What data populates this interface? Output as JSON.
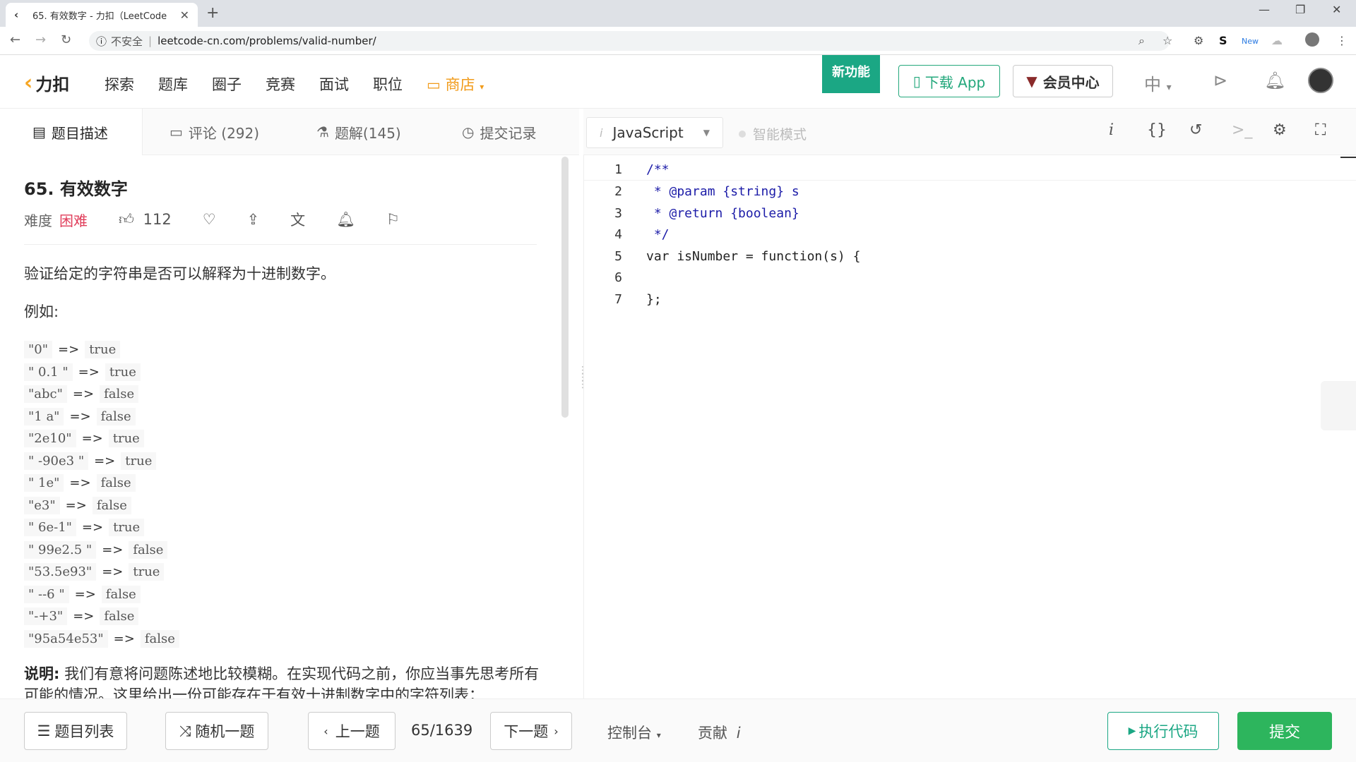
{
  "browser": {
    "tab_title": "65. 有效数字 - 力扣（LeetCode",
    "new_tab_symbol": "+",
    "security_label": "不安全",
    "url": "leetcode-cn.com/problems/valid-number/",
    "ext_new_badge": "New"
  },
  "header": {
    "logo_text": "力扣",
    "nav": [
      "探索",
      "题库",
      "圈子",
      "竞赛",
      "面试",
      "职位"
    ],
    "store_label": "商店",
    "new_feature_label": "新功能",
    "download_app_label": "下载 App",
    "vip_label": "会员中心",
    "lang_switch_label": "中"
  },
  "left_tabs": {
    "description": "题目描述",
    "comments": "评论 (292)",
    "solutions": "题解(145)",
    "submissions": "提交记录"
  },
  "problem": {
    "title": "65. 有效数字",
    "difficulty_label": "难度",
    "difficulty": "困难",
    "likes": "112",
    "description": "验证给定的字符串是否可以解释为十进制数字。",
    "example_label": "例如:",
    "examples": [
      {
        "input": "\"0\"",
        "output": "true"
      },
      {
        "input": "\" 0.1 \"",
        "output": "true"
      },
      {
        "input": "\"abc\"",
        "output": "false"
      },
      {
        "input": "\"1 a\"",
        "output": "false"
      },
      {
        "input": "\"2e10\"",
        "output": "true"
      },
      {
        "input": "\" -90e3      \"",
        "output": "true"
      },
      {
        "input": "\" 1e\"",
        "output": "false"
      },
      {
        "input": "\"e3\"",
        "output": "false"
      },
      {
        "input": "\" 6e-1\"",
        "output": "true"
      },
      {
        "input": "\" 99e2.5  \"",
        "output": "false"
      },
      {
        "input": "\"53.5e93\"",
        "output": "true"
      },
      {
        "input": "\" --6 \"",
        "output": "false"
      },
      {
        "input": "\"-+3\"",
        "output": "false"
      },
      {
        "input": "\"95a54e53\"",
        "output": "false"
      }
    ],
    "arrow": "=>",
    "note_label": "说明:",
    "note_text": "我们有意将问题陈述地比较模糊。在实现代码之前，你应当事先思考所有可能的情况。这里给出一份可能存在于有效十进制数字中的字符列表："
  },
  "editor": {
    "language": "JavaScript",
    "smart_mode_label": "智能模式",
    "lines": [
      {
        "num": "1",
        "text": "/**",
        "cls": "c-comment"
      },
      {
        "num": "2",
        "text": " * @param {string} s",
        "cls": "c-comment"
      },
      {
        "num": "3",
        "text": " * @return {boolean}",
        "cls": "c-comment"
      },
      {
        "num": "4",
        "text": " */",
        "cls": "c-comment"
      },
      {
        "num": "5",
        "text": "var isNumber = function(s) {",
        "cls": "c-plain"
      },
      {
        "num": "6",
        "text": "",
        "cls": "c-plain"
      },
      {
        "num": "7",
        "text": "};",
        "cls": "c-plain"
      }
    ]
  },
  "bottom": {
    "problem_list": "题目列表",
    "random": "随机一题",
    "prev": "上一题",
    "progress": "65/1639",
    "next": "下一题",
    "console": "控制台",
    "contribute": "贡献",
    "run": "执行代码",
    "submit": "提交"
  },
  "colors": {
    "accent_green": "#1ba784",
    "submit_green": "#2db55d",
    "hard_red": "#e03e5b",
    "store_orange": "#f19b1a"
  }
}
